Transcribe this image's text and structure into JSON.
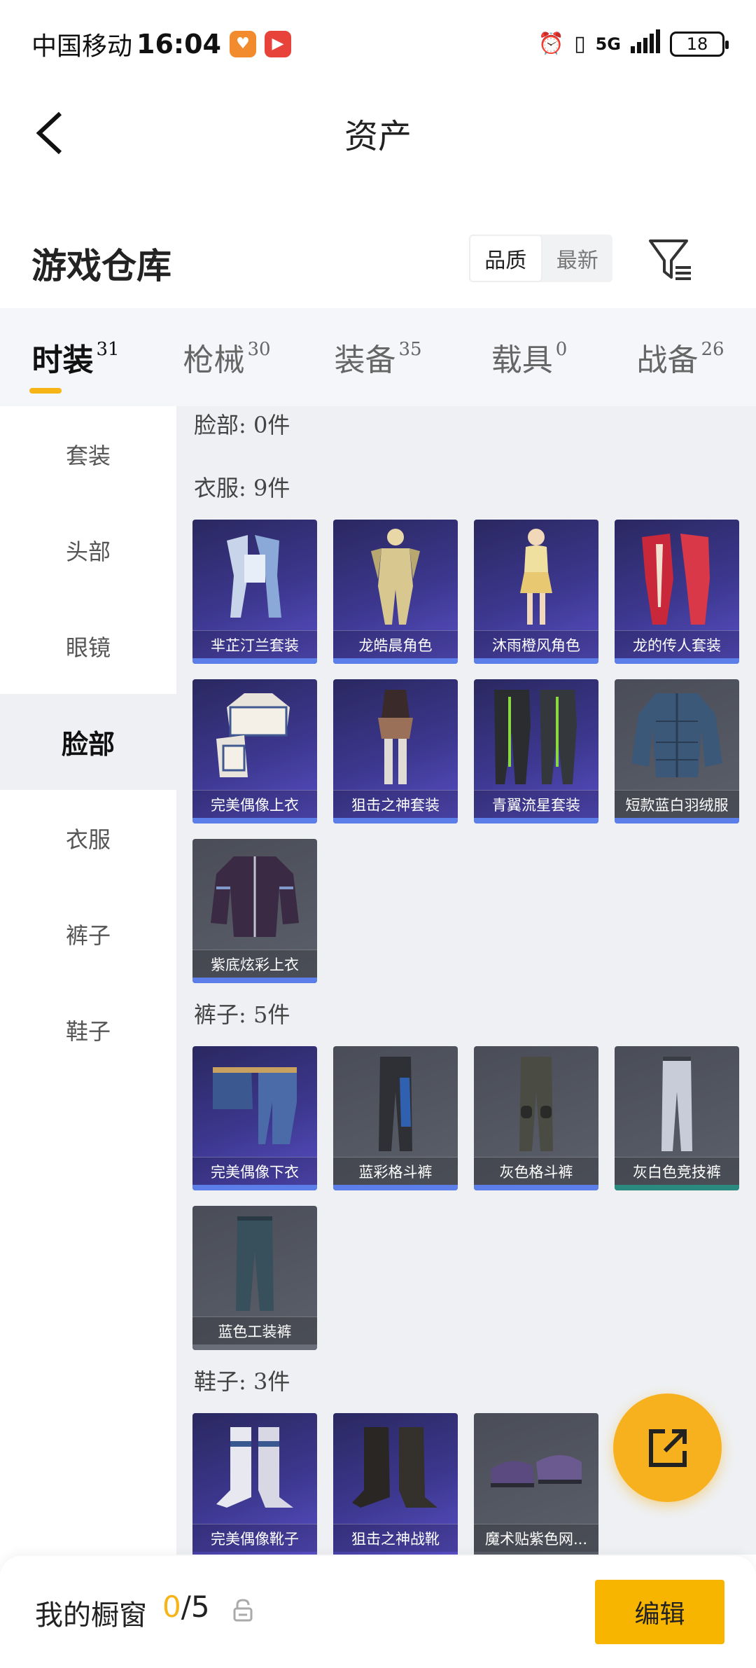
{
  "status_bar": {
    "carrier": "中国移动",
    "time": "16:04",
    "network": "5G",
    "battery": "18"
  },
  "header": {
    "title": "资产"
  },
  "warehouse": {
    "title": "游戏仓库",
    "sort_options": [
      "品质",
      "最新"
    ],
    "active_sort": "品质"
  },
  "tabs": [
    {
      "label": "时装",
      "count": "31",
      "active": true
    },
    {
      "label": "枪械",
      "count": "30",
      "active": false
    },
    {
      "label": "装备",
      "count": "35",
      "active": false
    },
    {
      "label": "载具",
      "count": "0",
      "active": false
    },
    {
      "label": "战备",
      "count": "26",
      "active": false
    }
  ],
  "sidebar": {
    "items": [
      "套装",
      "头部",
      "眼镜",
      "脸部",
      "衣服",
      "裤子",
      "鞋子"
    ],
    "active": "脸部"
  },
  "sections": {
    "face": {
      "title": "脸部: 0件"
    },
    "clothes": {
      "title": "衣服: 9件",
      "items": [
        {
          "name": "芈芷汀兰套装",
          "tier": "purple"
        },
        {
          "name": "龙皓晨角色",
          "tier": "purple"
        },
        {
          "name": "沐雨橙风角色",
          "tier": "purple"
        },
        {
          "name": "龙的传人套装",
          "tier": "purple"
        },
        {
          "name": "完美偶像上衣",
          "tier": "purple"
        },
        {
          "name": "狙击之神套装",
          "tier": "purple"
        },
        {
          "name": "青翼流星套装",
          "tier": "purple"
        },
        {
          "name": "短款蓝白羽绒服",
          "tier": "gray"
        },
        {
          "name": "紫底炫彩上衣",
          "tier": "gray"
        }
      ]
    },
    "pants": {
      "title": "裤子: 5件",
      "items": [
        {
          "name": "完美偶像下衣",
          "tier": "purple"
        },
        {
          "name": "蓝彩格斗裤",
          "tier": "gray"
        },
        {
          "name": "灰色格斗裤",
          "tier": "gray"
        },
        {
          "name": "灰白色竞技裤",
          "tier": "gray"
        },
        {
          "name": "蓝色工装裤",
          "tier": "gray"
        }
      ]
    },
    "shoes": {
      "title": "鞋子: 3件",
      "items": [
        {
          "name": "完美偶像靴子",
          "tier": "purple"
        },
        {
          "name": "狙击之神战靴",
          "tier": "purple"
        },
        {
          "name": "魔术贴紫色网...",
          "tier": "gray"
        }
      ]
    }
  },
  "bottom_bar": {
    "label": "我的橱窗",
    "current": "0",
    "total": "/5",
    "edit_label": "编辑"
  },
  "colors": {
    "accent": "#f7b500",
    "purple_card": "#3d3890",
    "gray_card": "#5c606b",
    "blue_bar": "#5b7ee8",
    "teal_bar": "#2a8a80"
  }
}
